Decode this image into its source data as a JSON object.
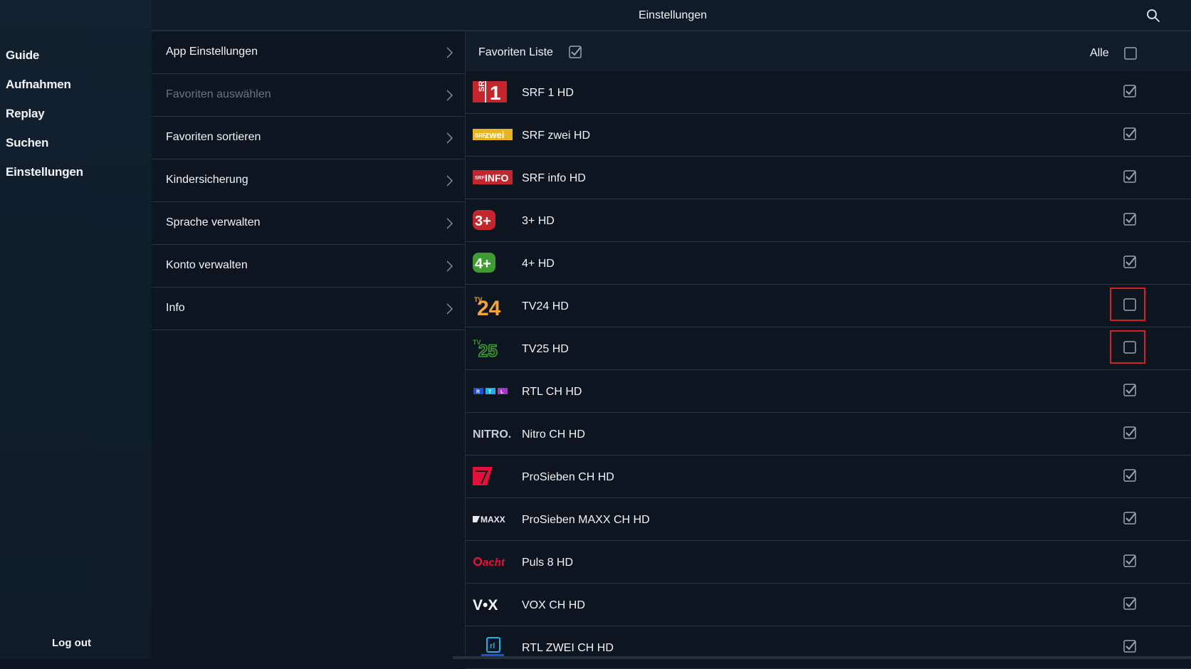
{
  "sidebar": {
    "items": [
      {
        "label": "Guide"
      },
      {
        "label": "Aufnahmen"
      },
      {
        "label": "Replay"
      },
      {
        "label": "Suchen"
      },
      {
        "label": "Einstellungen"
      }
    ],
    "logout_label": "Log out"
  },
  "topbar": {
    "title": "Einstellungen",
    "search_icon": "search-icon"
  },
  "menu": {
    "items": [
      {
        "label": "App Einstellungen",
        "disabled": false
      },
      {
        "label": "Favoriten auswählen",
        "disabled": true
      },
      {
        "label": "Favoriten sortieren",
        "disabled": false
      },
      {
        "label": "Kindersicherung",
        "disabled": false
      },
      {
        "label": "Sprache verwalten",
        "disabled": false
      },
      {
        "label": "Konto verwalten",
        "disabled": false
      },
      {
        "label": "Info",
        "disabled": false
      }
    ]
  },
  "list_header": {
    "title": "Favoriten Liste",
    "title_checked": true,
    "all_label": "Alle",
    "all_checked": false
  },
  "channels": [
    {
      "name": "SRF 1 HD",
      "checked": true,
      "logo": "srf1-logo"
    },
    {
      "name": "SRF zwei HD",
      "checked": true,
      "logo": "srf-zwei-logo"
    },
    {
      "name": "SRF info HD",
      "checked": true,
      "logo": "srf-info-logo"
    },
    {
      "name": "3+ HD",
      "checked": true,
      "logo": "3plus-logo"
    },
    {
      "name": "4+ HD",
      "checked": true,
      "logo": "4plus-logo"
    },
    {
      "name": "TV24 HD",
      "checked": false,
      "logo": "tv24-logo",
      "highlighted": true
    },
    {
      "name": "TV25 HD",
      "checked": false,
      "logo": "tv25-logo",
      "highlighted": true
    },
    {
      "name": "RTL CH HD",
      "checked": true,
      "logo": "rtl-logo"
    },
    {
      "name": "Nitro CH HD",
      "checked": true,
      "logo": "nitro-logo"
    },
    {
      "name": "ProSieben CH HD",
      "checked": true,
      "logo": "prosieben-logo"
    },
    {
      "name": "ProSieben MAXX CH HD",
      "checked": true,
      "logo": "prosieben-maxx-logo"
    },
    {
      "name": "Puls 8 HD",
      "checked": true,
      "logo": "puls8-logo"
    },
    {
      "name": "VOX CH HD",
      "checked": true,
      "logo": "vox-logo"
    },
    {
      "name": "RTL ZWEI CH HD",
      "checked": true,
      "logo": "rtl-zwei-logo"
    }
  ],
  "logo_text": {
    "srf": "SRF",
    "one": "1",
    "zwei": "zwei",
    "info": "INFO",
    "three": "3+",
    "four": "4+",
    "tv": "TV",
    "n24": "24",
    "n25": "25",
    "rtl_r": "R",
    "rtl_t": "T",
    "rtl_l": "L",
    "nitro": "NITRO.",
    "maxx": "MAXX",
    "acht": "acht",
    "vox": "V•X"
  },
  "colors": {
    "highlight": "#d42020",
    "check": "#9aa3ad",
    "srf_red": "#c4262e",
    "srf_yellow": "#e8b423"
  }
}
